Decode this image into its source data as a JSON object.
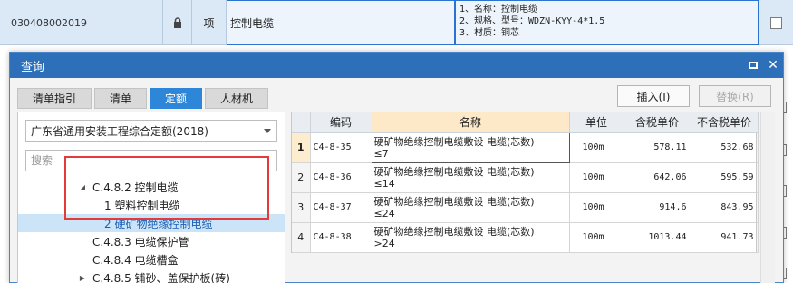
{
  "background_row": {
    "code": "030408002019",
    "unit": "项",
    "name": "控制电缆",
    "description": [
      "1、名称：控制电缆",
      "2、规格、型号：WDZN-KYY-4*1.5",
      "3、材质：铜芯"
    ]
  },
  "dialog": {
    "title": "查询",
    "tabs": [
      "清单指引",
      "清单",
      "定额",
      "人材机"
    ],
    "active_tab": "定额",
    "insert_label": "插入(I)",
    "replace_label": "替换(R)",
    "library": "广东省通用安装工程综合定额(2018)",
    "search_placeholder": "搜索",
    "tree": [
      {
        "label": "C.4.8.2 控制电缆",
        "toggle": "◢"
      },
      {
        "label": "1 塑料控制电缆"
      },
      {
        "label": "2 硬矿物绝缘控制电缆"
      },
      {
        "label": "C.4.8.3 电缆保护管"
      },
      {
        "label": "C.4.8.4 电缆槽盒"
      },
      {
        "label": "C.4.8.5 铺砂、盖保护板(砖)",
        "toggle": "▶"
      }
    ],
    "grid": {
      "headers": [
        "编码",
        "名称",
        "单位",
        "含税单价",
        "不含税单价"
      ],
      "rows": [
        {
          "idx": "1",
          "code": "C4-8-35",
          "name": "硬矿物绝缘控制电缆敷设 电缆(芯数)\n≤7",
          "unit": "100m",
          "tax_price": "578.11",
          "notax_price": "532.68"
        },
        {
          "idx": "2",
          "code": "C4-8-36",
          "name": "硬矿物绝缘控制电缆敷设 电缆(芯数)\n≤14",
          "unit": "100m",
          "tax_price": "642.06",
          "notax_price": "595.59"
        },
        {
          "idx": "3",
          "code": "C4-8-37",
          "name": "硬矿物绝缘控制电缆敷设 电缆(芯数)\n≤24",
          "unit": "100m",
          "tax_price": "914.6",
          "notax_price": "843.95"
        },
        {
          "idx": "4",
          "code": "C4-8-38",
          "name": "硬矿物绝缘控制电缆敷设 电缆(芯数)\n>24",
          "unit": "100m",
          "tax_price": "1013.44",
          "notax_price": "941.73"
        }
      ]
    }
  },
  "colors": {
    "titlebar": "#2d6fb8",
    "active_tab": "#2d86d8",
    "highlight_box": "#e23b3b",
    "name_header": "#fde9c8"
  }
}
